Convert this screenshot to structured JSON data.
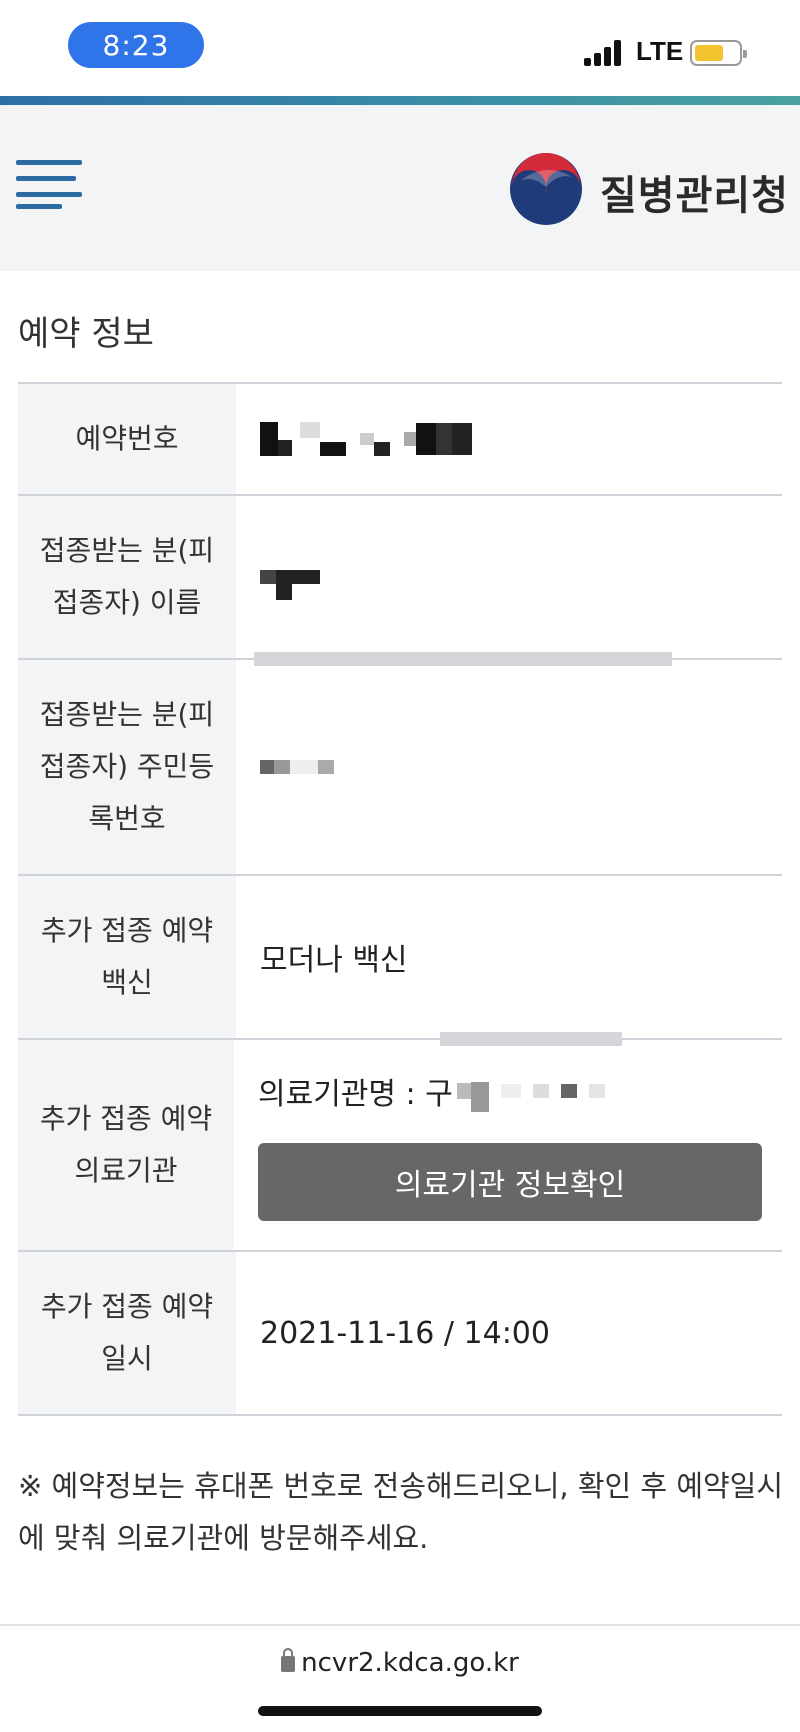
{
  "status_bar": {
    "time": "8:23",
    "network": "LTE",
    "battery_color": "#f4c430"
  },
  "header": {
    "brand": "질병관리청",
    "accent_color": "#2d6ba3"
  },
  "section": {
    "title": "예약 정보"
  },
  "rows": {
    "reservation_number_label": "예약번호",
    "name_label": "접종받는 분(피접종자) 이름",
    "resident_id_label": "접종받는 분(피접종자) 주민등록번호",
    "vaccine_label": "추가 접종 예약 백신",
    "vaccine_value": "모더나 백신",
    "facility_label": "추가 접종 예약 의료기관",
    "facility_prefix": "의료기관명 : 구",
    "facility_button": "의료기관 정보확인",
    "datetime_label": "추가 접종 예약 일시",
    "datetime_value": "2021-11-16 / 14:00"
  },
  "notice": "※ 예약정보는 휴대폰 번호로 전송해드리오니, 확인 후 예약일시에 맞춰 의료기관에 방문해주세요.",
  "browser": {
    "url": "ncvr2.kdca.go.kr"
  },
  "colors": {
    "date": "#2c5f96",
    "button": "#676767",
    "label_bg": "#f3f4f6"
  }
}
